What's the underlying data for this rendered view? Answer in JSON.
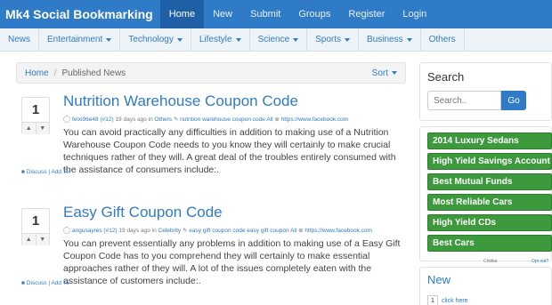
{
  "navbar": {
    "brand": "Mk4 Social Bookmarking",
    "items": [
      "Home",
      "New",
      "Submit",
      "Groups",
      "Register",
      "Login"
    ],
    "active": "Home"
  },
  "categories": [
    {
      "label": "News",
      "dropdown": false
    },
    {
      "label": "Entertainment",
      "dropdown": true
    },
    {
      "label": "Technology",
      "dropdown": true
    },
    {
      "label": "Lifestyle",
      "dropdown": true
    },
    {
      "label": "Science",
      "dropdown": true
    },
    {
      "label": "Sports",
      "dropdown": true
    },
    {
      "label": "Business",
      "dropdown": true
    },
    {
      "label": "Others",
      "dropdown": false
    }
  ],
  "breadcrumb": {
    "home": "Home",
    "sep": "/",
    "current": "Published News",
    "sort": "Sort"
  },
  "stories": [
    {
      "votes": "1",
      "title": "Nutrition Warehouse Coupon Code",
      "user": "felxi96e48 (#12)",
      "time": "19 days ago in",
      "category": "Others",
      "tags": "nutrition warehouse coupon code All",
      "source": "https://www.facebook.com",
      "body": "You can avoid practically any difficulties in addition to making use of a Nutrition Warehouse Coupon Code needs to you know they will certainly to make crucial techniques rather of they will. A great deal of the troubles entirely consumed with the assistance of consumers include:.",
      "discuss": "Discuss",
      "add": "Add To"
    },
    {
      "votes": "1",
      "title": "Easy Gift Coupon Code",
      "user": "angusayres (#12)",
      "time": "19 days ago in",
      "category": "Celebrity",
      "tags": "easy gift coupon code easy gift coupon All",
      "source": "https://www.facebook.com",
      "body": "You can prevent essentially any problems in addition to making use of a Easy Gift Coupon Code has to you comprehend they will certainly to make essential approaches rather of they will. A lot of the issues completely eaten with the assistance of customers include:.",
      "discuss": "Discuss",
      "add": "Add To"
    }
  ],
  "sidebar": {
    "search_title": "Search",
    "search_placeholder": "Search..",
    "search_button": "Go",
    "links": [
      "2014 Luxury Sedans",
      "High Yield Savings Account",
      "Best Mutual Funds",
      "Most Reliable Cars",
      "High Yield CDs",
      "Best Cars"
    ],
    "chitika": "Chitika",
    "optout": "Opt out?",
    "new_title": "New",
    "new_item_votes": "1",
    "new_item": "click here"
  },
  "colors": {
    "brand_blue": "#2f7bc7",
    "active_nav": "#1f5fa5",
    "link_green": "#3c9a3c"
  }
}
